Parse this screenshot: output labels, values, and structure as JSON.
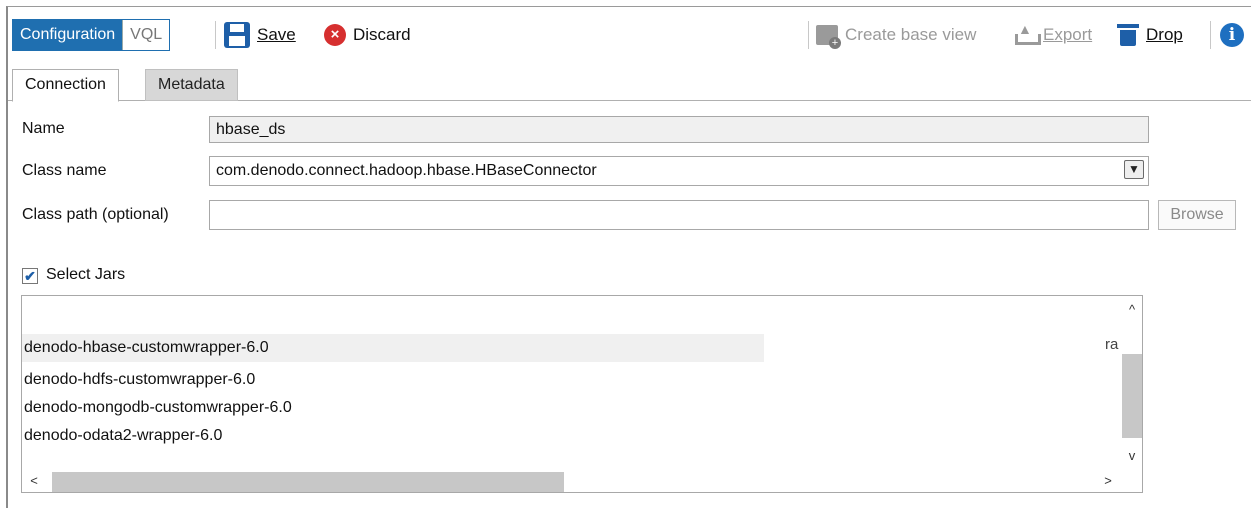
{
  "toolbar": {
    "mode_configuration": "Configuration",
    "mode_vql": "VQL",
    "save_label": "Save",
    "discard_label": "Discard",
    "create_base_view_label": "Create base view",
    "export_label": "Export",
    "drop_label": "Drop",
    "info_glyph": "i",
    "discard_glyph": "×"
  },
  "tabs": [
    {
      "label": "Connection",
      "active": true
    },
    {
      "label": "Metadata",
      "active": false
    }
  ],
  "form": {
    "name_label": "Name",
    "name_value": "hbase_ds",
    "class_name_label": "Class name",
    "class_name_value": "com.denodo.connect.hadoop.hbase.HBaseConnector",
    "class_path_label": "Class path (optional)",
    "class_path_value": "",
    "browse_label": "Browse",
    "select_jars_label": "Select Jars",
    "select_jars_checked": true,
    "check_glyph": "✔"
  },
  "jars": [
    "denodo-hbase-customwrapper-6.0",
    "denodo-hdfs-customwrapper-6.0",
    "denodo-mongodb-customwrapper-6.0",
    "denodo-odata2-wrapper-6.0"
  ],
  "list_overflow_text": "ra",
  "colors": {
    "accent": "#1f6fb0",
    "discard": "#d62f2f",
    "disabled_text": "#9a9a9a",
    "scroll_thumb": "#c7c7c7"
  },
  "icons": [
    "save-icon",
    "discard-icon",
    "create-base-view-icon",
    "export-icon",
    "drop-icon",
    "info-icon",
    "dropdown-arrow-icon",
    "checkbox-check-icon"
  ]
}
